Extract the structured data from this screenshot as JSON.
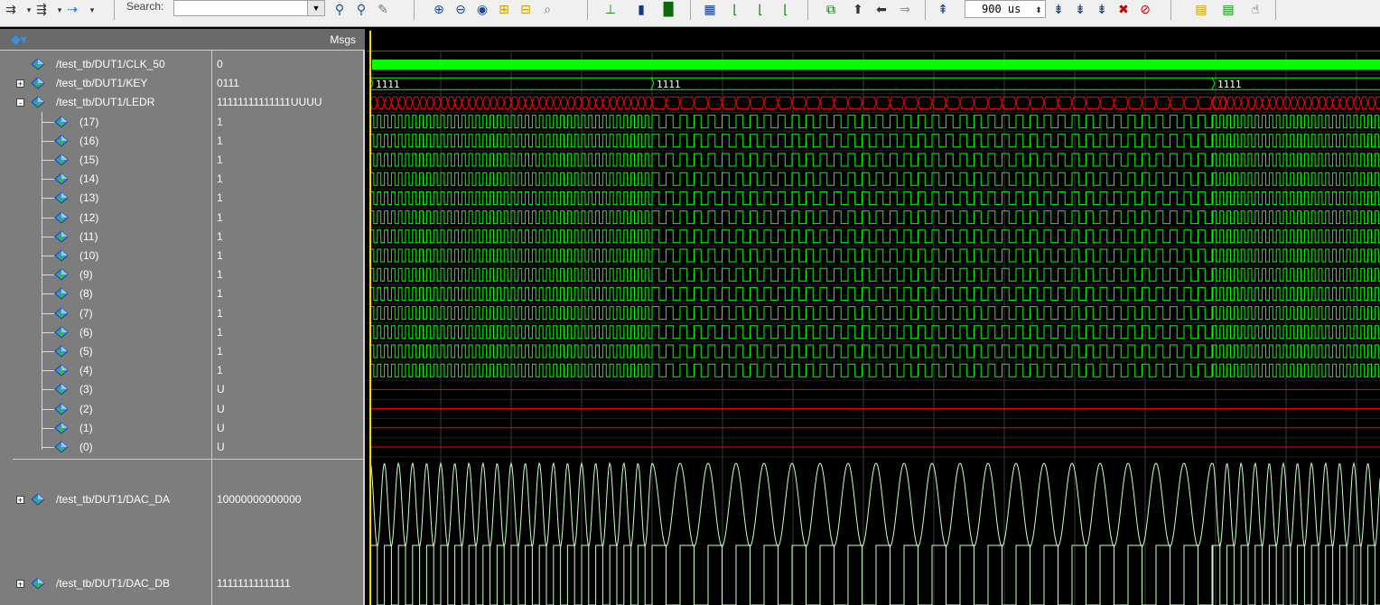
{
  "toolbar": {
    "search_label": "Search:",
    "search_value": "",
    "time_value": "900 us",
    "icons": [
      "step-icon",
      "step-over-icon",
      "continue-icon",
      "find-icon",
      "find-next-icon",
      "zoom-in-icon",
      "zoom-out-icon",
      "zoom-fit-icon",
      "zoom-full-icon",
      "zoom-cursor-icon",
      "insert-cursor-icon",
      "cursor-bar-icon",
      "wave-format-icon",
      "edge-prev-icon",
      "edge-next-icon",
      "run-icon",
      "restart-icon",
      "break-icon",
      "stop-icon",
      "bookmark-icon",
      "hand-icon"
    ]
  },
  "header": {
    "msgs_label": "Msgs"
  },
  "signals": [
    {
      "name": "/test_tb/DUT1/CLK_50",
      "value": "0",
      "expander": ""
    },
    {
      "name": "/test_tb/DUT1/KEY",
      "value": "0111",
      "expander": "+"
    },
    {
      "name": "/test_tb/DUT1/LEDR",
      "value": "11111111111111UUUU",
      "expander": "-"
    },
    {
      "name": "(17)",
      "value": "1",
      "expander": ""
    },
    {
      "name": "(16)",
      "value": "1",
      "expander": ""
    },
    {
      "name": "(15)",
      "value": "1",
      "expander": ""
    },
    {
      "name": "(14)",
      "value": "1",
      "expander": ""
    },
    {
      "name": "(13)",
      "value": "1",
      "expander": ""
    },
    {
      "name": "(12)",
      "value": "1",
      "expander": ""
    },
    {
      "name": "(11)",
      "value": "1",
      "expander": ""
    },
    {
      "name": "(10)",
      "value": "1",
      "expander": ""
    },
    {
      "name": "(9)",
      "value": "1",
      "expander": ""
    },
    {
      "name": "(8)",
      "value": "1",
      "expander": ""
    },
    {
      "name": "(7)",
      "value": "1",
      "expander": ""
    },
    {
      "name": "(6)",
      "value": "1",
      "expander": ""
    },
    {
      "name": "(5)",
      "value": "1",
      "expander": ""
    },
    {
      "name": "(4)",
      "value": "1",
      "expander": ""
    },
    {
      "name": "(3)",
      "value": "U",
      "expander": ""
    },
    {
      "name": "(2)",
      "value": "U",
      "expander": ""
    },
    {
      "name": "(1)",
      "value": "U",
      "expander": ""
    },
    {
      "name": "(0)",
      "value": "U",
      "expander": ""
    },
    {
      "name": "/test_tb/DUT1/DAC_DA",
      "value": "10000000000000",
      "expander": "+"
    },
    {
      "name": "/test_tb/DUT1/DAC_DB",
      "value": "11111111111111",
      "expander": "+"
    }
  ],
  "bus_labels": {
    "key": [
      "1111",
      "1111",
      "1111"
    ]
  },
  "colors": {
    "wave_green": "#00ff00",
    "wave_red": "#ff0000",
    "analog": "#c8ffc8",
    "cursor": "#ffd400",
    "grid": "#3a3a3a"
  }
}
